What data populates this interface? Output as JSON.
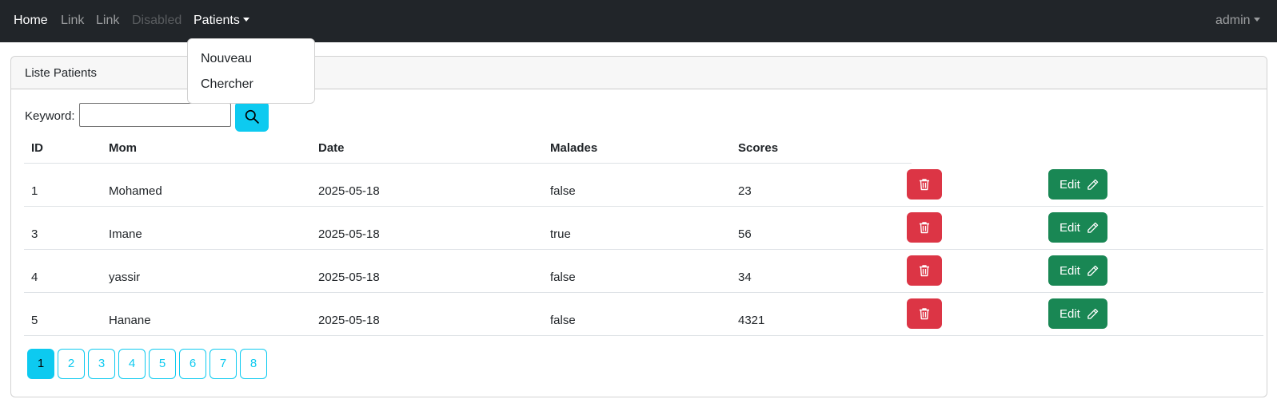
{
  "navbar": {
    "links": [
      {
        "label": "Home",
        "state": "active"
      },
      {
        "label": "Link",
        "state": "normal"
      },
      {
        "label": "Link",
        "state": "normal"
      },
      {
        "label": "Disabled",
        "state": "disabled"
      },
      {
        "label": "Patients",
        "state": "open-dropdown"
      }
    ],
    "user_menu": "admin"
  },
  "dropdown": {
    "items": [
      "Nouveau",
      "Chercher"
    ]
  },
  "card": {
    "title": "Liste Patients"
  },
  "search": {
    "label": "Keyword:",
    "value": "",
    "icon": "search-icon"
  },
  "table": {
    "headers": [
      "ID",
      "Mom",
      "Date",
      "Malades",
      "Scores"
    ],
    "rows": [
      {
        "id": "1",
        "name": "Mohamed",
        "date": "2025-05-18",
        "malade": "false",
        "score": "23"
      },
      {
        "id": "3",
        "name": "Imane",
        "date": "2025-05-18",
        "malade": "true",
        "score": "56"
      },
      {
        "id": "4",
        "name": "yassir",
        "date": "2025-05-18",
        "malade": "false",
        "score": "34"
      },
      {
        "id": "5",
        "name": "Hanane",
        "date": "2025-05-18",
        "malade": "false",
        "score": "4321"
      }
    ],
    "delete_icon": "trash-icon",
    "edit_label": "Edit",
    "edit_icon": "pencil-icon"
  },
  "pagination": {
    "pages": [
      "1",
      "2",
      "3",
      "4",
      "5",
      "6",
      "7",
      "8"
    ],
    "current": "1"
  },
  "colors": {
    "navbar_bg": "#212529",
    "info": "#0dcaf0",
    "danger": "#dc3545",
    "success": "#198754"
  }
}
